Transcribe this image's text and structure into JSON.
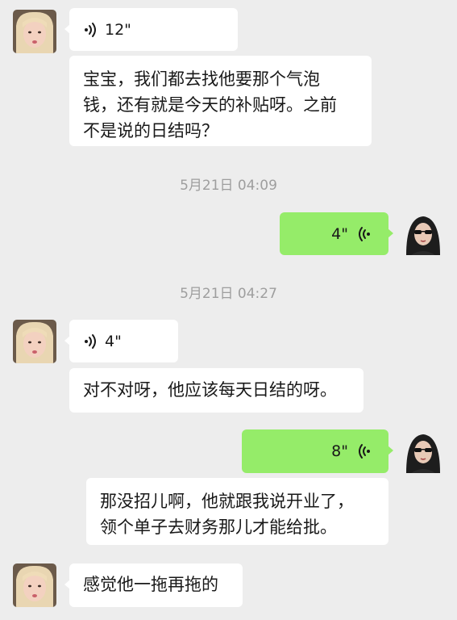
{
  "messages": [
    {
      "type": "voice",
      "side": "in",
      "duration": "12\""
    },
    {
      "type": "text",
      "side": "in",
      "lines": [
        "宝宝，我们都去找他要那个气泡",
        "钱，还有就是今天的补贴呀。之前",
        "不是说的日结吗？"
      ]
    },
    {
      "type": "timestamp",
      "text": "5月21日 04:09"
    },
    {
      "type": "voice",
      "side": "out",
      "duration": "4\""
    },
    {
      "type": "timestamp",
      "text": "5月21日 04:27"
    },
    {
      "type": "voice",
      "side": "in",
      "duration": "4\""
    },
    {
      "type": "text",
      "side": "in",
      "lines": [
        "对不对呀，他应该每天日结的呀。"
      ]
    },
    {
      "type": "voice",
      "side": "out",
      "duration": "8\""
    },
    {
      "type": "text",
      "side": "in",
      "lines": [
        "那没招儿啊，他就跟我说开业了，",
        "领个单子去财务那儿才能给批。"
      ]
    },
    {
      "type": "text",
      "side": "in",
      "lines": [
        "感觉他一拖再拖的"
      ]
    }
  ],
  "colors": {
    "background": "#ededed",
    "incoming_bubble": "#ffffff",
    "outgoing_bubble": "#95ec69",
    "timestamp_text": "#9e9e9e"
  },
  "icons": {
    "incoming_voice": "voice-wave-icon",
    "outgoing_voice": "voice-wave-icon",
    "avatar_left": "blonde-avatar",
    "avatar_right": "sunglasses-avatar"
  }
}
